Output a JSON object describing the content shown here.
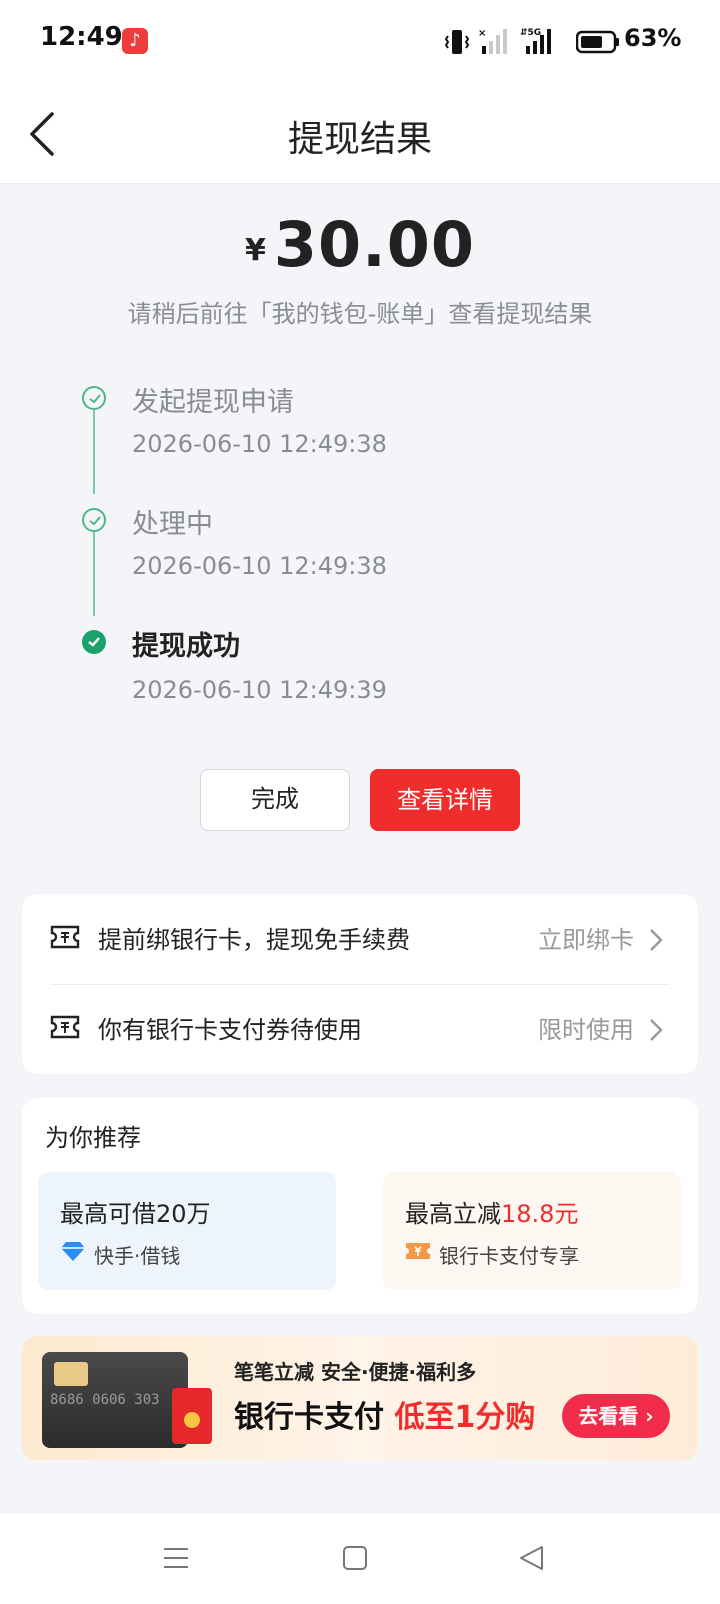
{
  "status": {
    "time": "12:49",
    "battery": "63%"
  },
  "header": {
    "title": "提现结果"
  },
  "result": {
    "currency": "¥",
    "amount": "30.00",
    "hint": "请稍后前往「我的钱包-账单」查看提现结果"
  },
  "timeline": [
    {
      "title": "发起提现申请",
      "time": "2026-06-10 12:49:38",
      "state": "done"
    },
    {
      "title": "处理中",
      "time": "2026-06-10 12:49:38",
      "state": "done"
    },
    {
      "title": "提现成功",
      "time": "2026-06-10 12:49:39",
      "state": "final"
    }
  ],
  "actions": {
    "done_label": "完成",
    "detail_label": "查看详情"
  },
  "offers": [
    {
      "text": "提前绑银行卡，提现免手续费",
      "action": "立即绑卡",
      "icon": "ticket-icon"
    },
    {
      "text": "你有银行卡支付券待使用",
      "action": "限时使用",
      "icon": "ticket-icon"
    }
  ],
  "recommend": {
    "title": "为你推荐",
    "items": [
      {
        "head": "最高可借20万",
        "sub": "快手·借钱",
        "icon": "diamond-icon"
      },
      {
        "head_prefix": "最高立减",
        "head_highlight": "18.8元",
        "sub": "银行卡支付专享",
        "icon": "coupon-icon"
      }
    ]
  },
  "banner": {
    "line1": "笔笔立减  安全·便捷·福利多",
    "line2_main": "银行卡支付",
    "line2_highlight": "低至1分购",
    "button": "去看看",
    "card_number": "8686 0606 303"
  },
  "colors": {
    "accent": "#f12c2c",
    "success": "#1aa26a",
    "background": "#f4f5f9"
  }
}
